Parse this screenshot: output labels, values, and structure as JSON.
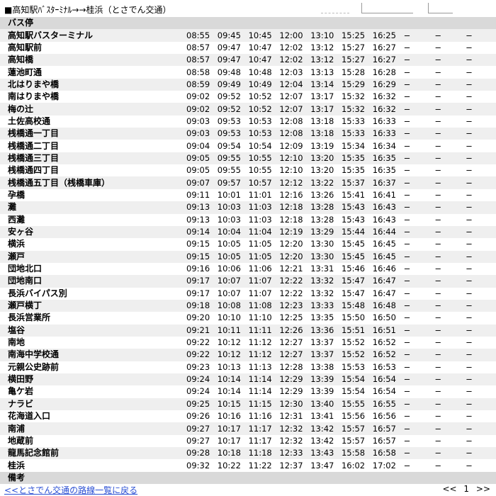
{
  "header": {
    "title": "■高知駅ﾊﾞｽﾀｰﾐﾅﾙ→→桂浜（とさでん交通）"
  },
  "table": {
    "header_label": "バス停",
    "rows": [
      {
        "stop": "高知駅バスターミナル",
        "times": [
          "08:55",
          "09:45",
          "10:45",
          "12:00",
          "13:10",
          "15:25",
          "16:25",
          "−",
          "−",
          "−"
        ]
      },
      {
        "stop": "高知駅前",
        "times": [
          "08:57",
          "09:47",
          "10:47",
          "12:02",
          "13:12",
          "15:27",
          "16:27",
          "−",
          "−",
          "−"
        ]
      },
      {
        "stop": "高知橋",
        "times": [
          "08:57",
          "09:47",
          "10:47",
          "12:02",
          "13:12",
          "15:27",
          "16:27",
          "−",
          "−",
          "−"
        ]
      },
      {
        "stop": "蓮池町通",
        "times": [
          "08:58",
          "09:48",
          "10:48",
          "12:03",
          "13:13",
          "15:28",
          "16:28",
          "−",
          "−",
          "−"
        ]
      },
      {
        "stop": "北はりまや橋",
        "times": [
          "08:59",
          "09:49",
          "10:49",
          "12:04",
          "13:14",
          "15:29",
          "16:29",
          "−",
          "−",
          "−"
        ]
      },
      {
        "stop": "南はりまや橋",
        "times": [
          "09:02",
          "09:52",
          "10:52",
          "12:07",
          "13:17",
          "15:32",
          "16:32",
          "−",
          "−",
          "−"
        ]
      },
      {
        "stop": "梅の辻",
        "times": [
          "09:02",
          "09:52",
          "10:52",
          "12:07",
          "13:17",
          "15:32",
          "16:32",
          "−",
          "−",
          "−"
        ]
      },
      {
        "stop": "土佐高校通",
        "times": [
          "09:03",
          "09:53",
          "10:53",
          "12:08",
          "13:18",
          "15:33",
          "16:33",
          "−",
          "−",
          "−"
        ]
      },
      {
        "stop": "桟橋通一丁目",
        "times": [
          "09:03",
          "09:53",
          "10:53",
          "12:08",
          "13:18",
          "15:33",
          "16:33",
          "−",
          "−",
          "−"
        ]
      },
      {
        "stop": "桟橋通二丁目",
        "times": [
          "09:04",
          "09:54",
          "10:54",
          "12:09",
          "13:19",
          "15:34",
          "16:34",
          "−",
          "−",
          "−"
        ]
      },
      {
        "stop": "桟橋通三丁目",
        "times": [
          "09:05",
          "09:55",
          "10:55",
          "12:10",
          "13:20",
          "15:35",
          "16:35",
          "−",
          "−",
          "−"
        ]
      },
      {
        "stop": "桟橋通四丁目",
        "times": [
          "09:05",
          "09:55",
          "10:55",
          "12:10",
          "13:20",
          "15:35",
          "16:35",
          "−",
          "−",
          "−"
        ]
      },
      {
        "stop": "桟橋通五丁目（桟橋車庫）",
        "times": [
          "09:07",
          "09:57",
          "10:57",
          "12:12",
          "13:22",
          "15:37",
          "16:37",
          "−",
          "−",
          "−"
        ]
      },
      {
        "stop": "孕橋",
        "times": [
          "09:11",
          "10:01",
          "11:01",
          "12:16",
          "13:26",
          "15:41",
          "16:41",
          "−",
          "−",
          "−"
        ]
      },
      {
        "stop": "灘",
        "times": [
          "09:13",
          "10:03",
          "11:03",
          "12:18",
          "13:28",
          "15:43",
          "16:43",
          "−",
          "−",
          "−"
        ]
      },
      {
        "stop": "西灘",
        "times": [
          "09:13",
          "10:03",
          "11:03",
          "12:18",
          "13:28",
          "15:43",
          "16:43",
          "−",
          "−",
          "−"
        ]
      },
      {
        "stop": "安ヶ谷",
        "times": [
          "09:14",
          "10:04",
          "11:04",
          "12:19",
          "13:29",
          "15:44",
          "16:44",
          "−",
          "−",
          "−"
        ]
      },
      {
        "stop": "横浜",
        "times": [
          "09:15",
          "10:05",
          "11:05",
          "12:20",
          "13:30",
          "15:45",
          "16:45",
          "−",
          "−",
          "−"
        ]
      },
      {
        "stop": "瀬戸",
        "times": [
          "09:15",
          "10:05",
          "11:05",
          "12:20",
          "13:30",
          "15:45",
          "16:45",
          "−",
          "−",
          "−"
        ]
      },
      {
        "stop": "団地北口",
        "times": [
          "09:16",
          "10:06",
          "11:06",
          "12:21",
          "13:31",
          "15:46",
          "16:46",
          "−",
          "−",
          "−"
        ]
      },
      {
        "stop": "団地南口",
        "times": [
          "09:17",
          "10:07",
          "11:07",
          "12:22",
          "13:32",
          "15:47",
          "16:47",
          "−",
          "−",
          "−"
        ]
      },
      {
        "stop": "長浜バイパス別",
        "times": [
          "09:17",
          "10:07",
          "11:07",
          "12:22",
          "13:32",
          "15:47",
          "16:47",
          "−",
          "−",
          "−"
        ]
      },
      {
        "stop": "瀬戸横丁",
        "times": [
          "09:18",
          "10:08",
          "11:08",
          "12:23",
          "13:33",
          "15:48",
          "16:48",
          "−",
          "−",
          "−"
        ]
      },
      {
        "stop": "長浜営業所",
        "times": [
          "09:20",
          "10:10",
          "11:10",
          "12:25",
          "13:35",
          "15:50",
          "16:50",
          "−",
          "−",
          "−"
        ]
      },
      {
        "stop": "塩谷",
        "times": [
          "09:21",
          "10:11",
          "11:11",
          "12:26",
          "13:36",
          "15:51",
          "16:51",
          "−",
          "−",
          "−"
        ]
      },
      {
        "stop": "南地",
        "times": [
          "09:22",
          "10:12",
          "11:12",
          "12:27",
          "13:37",
          "15:52",
          "16:52",
          "−",
          "−",
          "−"
        ]
      },
      {
        "stop": "南海中学校通",
        "times": [
          "09:22",
          "10:12",
          "11:12",
          "12:27",
          "13:37",
          "15:52",
          "16:52",
          "−",
          "−",
          "−"
        ]
      },
      {
        "stop": "元親公史跡前",
        "times": [
          "09:23",
          "10:13",
          "11:13",
          "12:28",
          "13:38",
          "15:53",
          "16:53",
          "−",
          "−",
          "−"
        ]
      },
      {
        "stop": "横田野",
        "times": [
          "09:24",
          "10:14",
          "11:14",
          "12:29",
          "13:39",
          "15:54",
          "16:54",
          "−",
          "−",
          "−"
        ]
      },
      {
        "stop": "亀ケ岩",
        "times": [
          "09:24",
          "10:14",
          "11:14",
          "12:29",
          "13:39",
          "15:54",
          "16:54",
          "−",
          "−",
          "−"
        ]
      },
      {
        "stop": "ナラビ",
        "times": [
          "09:25",
          "10:15",
          "11:15",
          "12:30",
          "13:40",
          "15:55",
          "16:55",
          "−",
          "−",
          "−"
        ]
      },
      {
        "stop": "花海道入口",
        "times": [
          "09:26",
          "10:16",
          "11:16",
          "12:31",
          "13:41",
          "15:56",
          "16:56",
          "−",
          "−",
          "−"
        ]
      },
      {
        "stop": "南浦",
        "times": [
          "09:27",
          "10:17",
          "11:17",
          "12:32",
          "13:42",
          "15:57",
          "16:57",
          "−",
          "−",
          "−"
        ]
      },
      {
        "stop": "地蔵前",
        "times": [
          "09:27",
          "10:17",
          "11:17",
          "12:32",
          "13:42",
          "15:57",
          "16:57",
          "−",
          "−",
          "−"
        ]
      },
      {
        "stop": "龍馬記念館前",
        "times": [
          "09:28",
          "10:18",
          "11:18",
          "12:33",
          "13:43",
          "15:58",
          "16:58",
          "−",
          "−",
          "−"
        ]
      },
      {
        "stop": "桂浜",
        "times": [
          "09:32",
          "10:22",
          "11:22",
          "12:37",
          "13:47",
          "16:02",
          "17:02",
          "−",
          "−",
          "−"
        ]
      }
    ],
    "note_label": "備考"
  },
  "footer": {
    "back_link": "<<とさでん交通の路線一覧に戻る",
    "pager_prev": "<<",
    "pager_page": "1",
    "pager_next": ">>"
  }
}
